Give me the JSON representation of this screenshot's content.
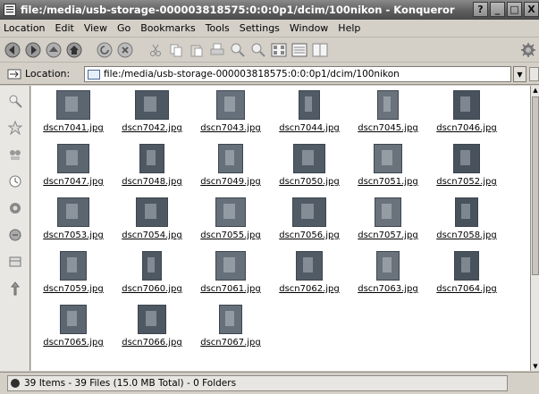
{
  "window": {
    "title": "file:/media/usb-storage-000003818575:0:0:0p1/dcim/100nikon - Konqueror",
    "buttons": {
      "help": "?",
      "minimize": "_",
      "maximize": "□",
      "close": "X"
    }
  },
  "menubar": {
    "items": [
      "Location",
      "Edit",
      "View",
      "Go",
      "Bookmarks",
      "Tools",
      "Settings",
      "Window",
      "Help"
    ]
  },
  "toolbar": {
    "icons": [
      "back-icon",
      "forward-icon",
      "up-icon",
      "home-icon",
      "reload-icon",
      "stop-icon",
      "cut-icon",
      "copy-icon",
      "paste-icon",
      "print-icon",
      "zoom-in-icon",
      "zoom-out-icon",
      "icon-view-icon",
      "detail-view-icon",
      "multicolumn-view-icon",
      "throbber-icon"
    ]
  },
  "locationbar": {
    "label": "Location:",
    "value": "file:/media/usb-storage-000003818575:0:0:0p1/dcim/100nikon"
  },
  "sidebar": {
    "icons": [
      "search-icon",
      "bookmarks-icon",
      "network-icon",
      "history-icon",
      "home-folder-icon",
      "services-icon",
      "media-icon",
      "root-folder-icon"
    ]
  },
  "files": [
    "dscn7041.jpg",
    "dscn7042.jpg",
    "dscn7043.jpg",
    "dscn7044.jpg",
    "dscn7045.jpg",
    "dscn7046.jpg",
    "dscn7047.jpg",
    "dscn7048.jpg",
    "dscn7049.jpg",
    "dscn7050.jpg",
    "dscn7051.jpg",
    "dscn7052.jpg",
    "dscn7053.jpg",
    "dscn7054.jpg",
    "dscn7055.jpg",
    "dscn7056.jpg",
    "dscn7057.jpg",
    "dscn7058.jpg",
    "dscn7059.jpg",
    "dscn7060.jpg",
    "dscn7061.jpg",
    "dscn7062.jpg",
    "dscn7063.jpg",
    "dscn7064.jpg",
    "dscn7065.jpg",
    "dscn7066.jpg",
    "dscn7067.jpg"
  ],
  "statusbar": {
    "text": "39 Items - 39 Files (15.0 MB Total) - 0 Folders"
  },
  "colors": {
    "titlebar": "#5f5f5f",
    "chrome": "#d4d0c8",
    "view_background": "#ffffff"
  }
}
